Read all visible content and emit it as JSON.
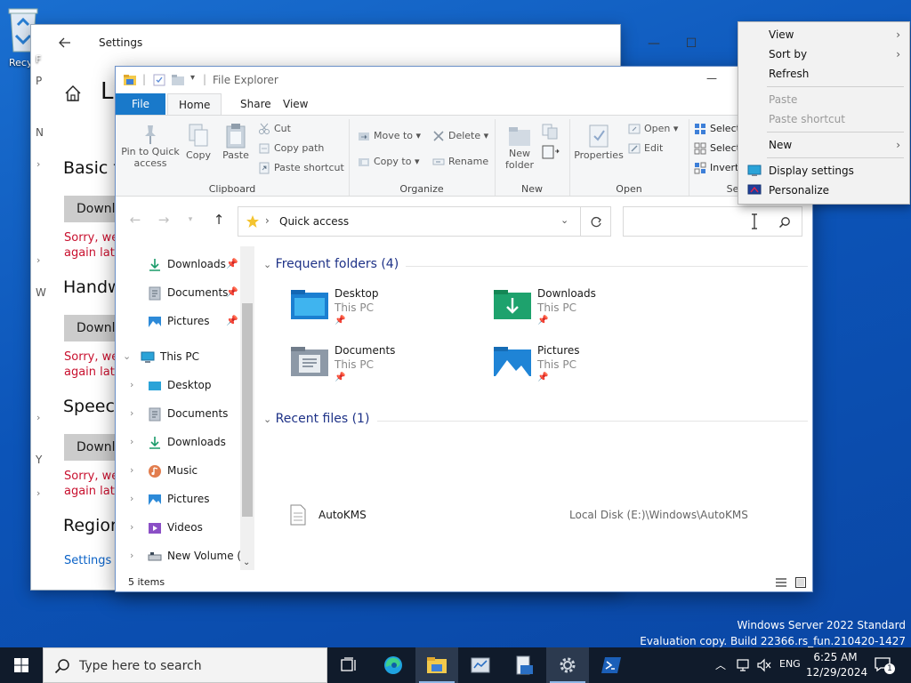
{
  "desktop": {
    "recycle_label": "Recy",
    "watermark_line1": "Windows Server 2022 Standard",
    "watermark_line2": "Evaluation copy. Build 22366.rs_fun.210420-1427"
  },
  "settings": {
    "title": "Settings",
    "page_title_partial": "La",
    "sections": [
      {
        "heading": "Basic ty",
        "button": "Downlo",
        "error1": "Sorry, we",
        "error2": "again late"
      },
      {
        "heading": "Handw",
        "button": "Downlo",
        "error1": "Sorry, we",
        "error2": "again late"
      },
      {
        "heading": "Speech",
        "button": "Downlo",
        "error1": "Sorry, we",
        "error2": "again late"
      }
    ],
    "region_heading": "Region",
    "settings_link": "Settings",
    "sidebar_letters": [
      "P",
      "N",
      "W",
      "Y"
    ],
    "partial_f": "F"
  },
  "explorer": {
    "title": "File Explorer",
    "tabs": {
      "file": "File",
      "home": "Home",
      "share": "Share",
      "view": "View"
    },
    "ribbon": {
      "pin": "Pin to Quick\naccess",
      "copy": "Copy",
      "paste": "Paste",
      "cut": "Cut",
      "copy_path": "Copy path",
      "paste_shortcut": "Paste shortcut",
      "group_clipboard": "Clipboard",
      "move_to": "Move to",
      "copy_to": "Copy to",
      "delete": "Delete",
      "rename": "Rename",
      "group_organize": "Organize",
      "new_folder": "New\nfolder",
      "group_new": "New",
      "properties": "Properties",
      "open": "Open",
      "edit": "Edit",
      "group_open": "Open",
      "select_all": "Select",
      "select_none": "Select",
      "invert": "Invert",
      "group_select": "Sel"
    },
    "address": "Quick access",
    "nav": {
      "quick": [
        {
          "label": "Downloads",
          "icon": "download-icon"
        },
        {
          "label": "Documents",
          "icon": "documents-icon"
        },
        {
          "label": "Pictures",
          "icon": "pictures-icon"
        }
      ],
      "this_pc": "This PC",
      "pc_items": [
        {
          "label": "Desktop",
          "icon": "desktop-icon"
        },
        {
          "label": "Documents",
          "icon": "documents-icon"
        },
        {
          "label": "Downloads",
          "icon": "download-icon"
        },
        {
          "label": "Music",
          "icon": "music-icon"
        },
        {
          "label": "Pictures",
          "icon": "pictures-icon"
        },
        {
          "label": "Videos",
          "icon": "videos-icon"
        },
        {
          "label": "New Volume (C",
          "icon": "drive-icon"
        }
      ]
    },
    "frequent_header": "Frequent folders (4)",
    "folders": [
      {
        "name": "Desktop",
        "sub": "This PC"
      },
      {
        "name": "Downloads",
        "sub": "This PC"
      },
      {
        "name": "Documents",
        "sub": "This PC"
      },
      {
        "name": "Pictures",
        "sub": "This PC"
      }
    ],
    "recent_header": "Recent files (1)",
    "recent_files": [
      {
        "name": "AutoKMS",
        "path": "Local Disk (E:)\\Windows\\AutoKMS"
      }
    ],
    "status": "5 items"
  },
  "context_menu": {
    "view": "View",
    "sort_by": "Sort by",
    "refresh": "Refresh",
    "paste": "Paste",
    "paste_shortcut": "Paste shortcut",
    "new": "New",
    "display_settings": "Display settings",
    "personalize": "Personalize"
  },
  "taskbar": {
    "search_placeholder": "Type here to search",
    "language": "ENG",
    "time": "6:25 AM",
    "date": "12/29/2024",
    "notification_count": "1"
  }
}
